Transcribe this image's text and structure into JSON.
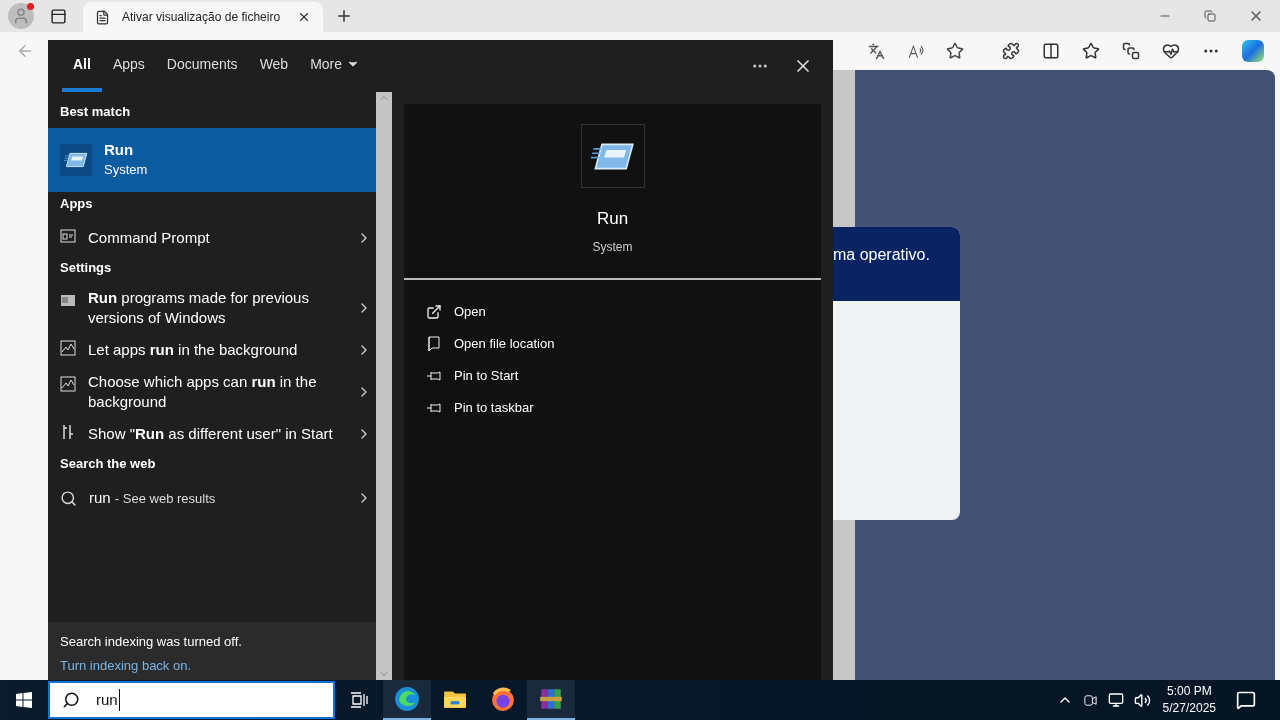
{
  "browser": {
    "tab_title": "Ativar visualização de ficheiro",
    "dialog_text": "ma operativo."
  },
  "search": {
    "tabs": [
      {
        "label": "All",
        "selected": true,
        "kind": "tab"
      },
      {
        "label": "Apps",
        "selected": false,
        "kind": "tab"
      },
      {
        "label": "Documents",
        "selected": false,
        "kind": "tab"
      },
      {
        "label": "Web",
        "selected": false,
        "kind": "tab"
      },
      {
        "label": "More",
        "selected": false,
        "kind": "dropdown"
      }
    ],
    "groups": [
      {
        "heading": "Best match",
        "items": [
          {
            "kind": "best",
            "text": "Run",
            "subtitle": "System",
            "selected": true
          }
        ]
      },
      {
        "heading": "Apps",
        "items": [
          {
            "kind": "row",
            "text": "Command Prompt",
            "selected": false
          }
        ]
      },
      {
        "heading": "Settings",
        "items": [
          {
            "kind": "row",
            "text": "**Run** programs made for previous versions of Windows",
            "selected": false
          },
          {
            "kind": "row",
            "text": "Let apps **run** in the background",
            "selected": false
          },
          {
            "kind": "row",
            "text": "Choose which apps can **run** in the background",
            "selected": false
          },
          {
            "kind": "row",
            "text": "Show \"**Run** as different user\" in Start",
            "selected": false
          }
        ]
      },
      {
        "heading": "Search the web",
        "items": [
          {
            "kind": "web",
            "text": "run",
            "subtitle": "- See web results",
            "selected": false
          }
        ]
      }
    ],
    "footer": {
      "note": "Search indexing was turned off.",
      "link": "Turn indexing back on."
    },
    "preview": {
      "title": "Run",
      "subtitle": "System",
      "actions": [
        "Open",
        "Open file location",
        "Pin to Start",
        "Pin to taskbar"
      ]
    }
  },
  "taskbar": {
    "search_value": "run",
    "apps": [
      {
        "running": true
      },
      {
        "running": false
      },
      {
        "running": false
      },
      {
        "running": true
      }
    ],
    "time": "5:00 PM",
    "date": "5/27/2025"
  }
}
